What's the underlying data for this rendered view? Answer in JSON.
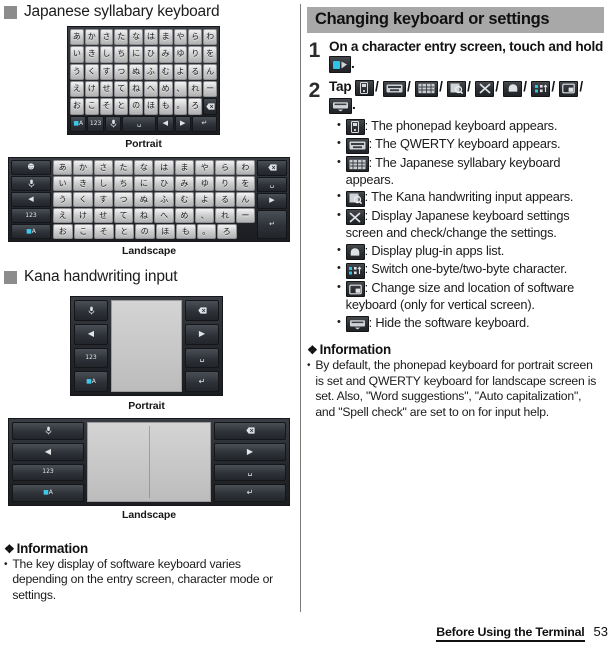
{
  "left": {
    "section1": {
      "title": "Japanese syllabary keyboard",
      "bullet_icon": "square-marker"
    },
    "portrait_caption_1": "Portrait",
    "landscape_caption_1": "Landscape",
    "section2": {
      "title": "Kana handwriting input",
      "bullet_icon": "square-marker"
    },
    "portrait_caption_2": "Portrait",
    "landscape_caption_2": "Landscape",
    "info": {
      "heading": "Information",
      "items": [
        "The key display of software keyboard varies depending on the entry screen, character mode or settings."
      ]
    },
    "keyboard_portrait": {
      "rows": [
        [
          "あ",
          "か",
          "さ",
          "た",
          "な",
          "は",
          "ま",
          "や",
          "ら",
          "わ"
        ],
        [
          "い",
          "き",
          "し",
          "ち",
          "に",
          "ひ",
          "み",
          "ゆ",
          "り",
          "を"
        ],
        [
          "う",
          "く",
          "す",
          "つ",
          "ぬ",
          "ふ",
          "む",
          "よ",
          "る",
          "ん"
        ],
        [
          "え",
          "け",
          "せ",
          "て",
          "ね",
          "へ",
          "め",
          "、",
          "れ",
          "ー"
        ],
        [
          "お",
          "こ",
          "そ",
          "と",
          "の",
          "ほ",
          "も",
          "。",
          "ろ",
          "⌫"
        ]
      ],
      "function_row": [
        "A",
        "123",
        "mic",
        "␣",
        "◀",
        "▶",
        "↵"
      ]
    },
    "keyboard_landscape": {
      "left_keys": [
        "☺",
        "mic",
        "◀",
        "123",
        "A"
      ],
      "rows": [
        [
          "あ",
          "か",
          "さ",
          "た",
          "な",
          "は",
          "ま",
          "や",
          "ら",
          "わ"
        ],
        [
          "い",
          "き",
          "し",
          "ち",
          "に",
          "ひ",
          "み",
          "ゆ",
          "り",
          "を"
        ],
        [
          "う",
          "く",
          "す",
          "つ",
          "ぬ",
          "ふ",
          "む",
          "よ",
          "る",
          "ん"
        ],
        [
          "え",
          "け",
          "せ",
          "て",
          "ね",
          "へ",
          "め",
          "、",
          "れ",
          "ー"
        ],
        [
          "お",
          "こ",
          "そ",
          "と",
          "の",
          "ほ",
          "も",
          "。",
          "ろ",
          ""
        ]
      ],
      "right_keys": [
        "⌫",
        "␣",
        "▶",
        "↵"
      ]
    },
    "handwriting_portrait": {
      "left_keys": [
        "mic",
        "◀",
        "123",
        "A"
      ],
      "right_keys": [
        "⌫",
        "▶",
        "␣",
        "↵"
      ]
    },
    "handwriting_landscape": {
      "left_keys": [
        "mic",
        "◀",
        "123",
        "A"
      ],
      "right_keys": [
        "⌫",
        "▶",
        "␣",
        "↵"
      ]
    }
  },
  "right": {
    "banner_title": "Changing keyboard or settings",
    "step1": {
      "number": "1",
      "text_before": "On a character entry screen, touch and hold",
      "icon": "ime-switch-icon",
      "text_after": "."
    },
    "step2": {
      "number": "2",
      "label": "Tap",
      "icons": [
        "phonepad-keyboard-icon",
        "qwerty-keyboard-icon",
        "japanese-syllabary-keyboard-icon",
        "kana-handwriting-icon",
        "settings-icon",
        "plugin-apps-icon",
        "byte-switch-icon",
        "resize-keyboard-icon",
        "hide-keyboard-icon"
      ],
      "trailing": ".",
      "bullets": [
        {
          "icon": "phonepad-keyboard-icon",
          "text": ": The phonepad keyboard appears."
        },
        {
          "icon": "qwerty-keyboard-icon",
          "text": ": The QWERTY keyboard appears."
        },
        {
          "icon": "japanese-syllabary-keyboard-icon",
          "text": ": The Japanese syllabary keyboard appears."
        },
        {
          "icon": "kana-handwriting-icon",
          "text": ": The Kana handwriting input appears."
        },
        {
          "icon": "settings-icon",
          "text": ": Display Japanese keyboard settings screen and check/change the settings."
        },
        {
          "icon": "plugin-apps-icon",
          "text": ": Display plug-in apps list."
        },
        {
          "icon": "byte-switch-icon",
          "text": ": Switch one-byte/two-byte character."
        },
        {
          "icon": "resize-keyboard-icon",
          "text": ": Change size and location of software keyboard (only for vertical screen)."
        },
        {
          "icon": "hide-keyboard-icon",
          "text": ": Hide the software keyboard."
        }
      ]
    },
    "info": {
      "heading": "Information",
      "items": [
        "By default, the phonepad keyboard for portrait screen is set and QWERTY keyboard for landscape screen is set. Also, \"Word suggestions\", \"Auto capitalization\", and \"Spell check\" are set to on for input help."
      ]
    }
  },
  "footer": {
    "chapter": "Before Using the Terminal",
    "page": "53"
  }
}
